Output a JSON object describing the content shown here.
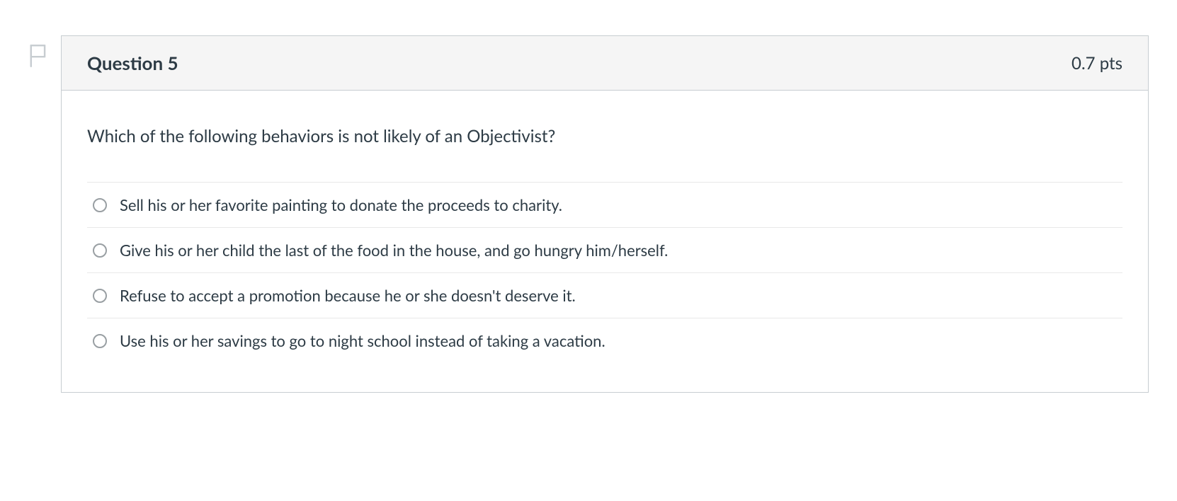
{
  "question": {
    "title": "Question 5",
    "points": "0.7 pts",
    "prompt": "Which of the following behaviors is not likely of an Objectivist?",
    "answers": [
      {
        "text": "Sell his or her favorite painting to donate the proceeds to charity."
      },
      {
        "text": "Give his or her child the last of the food in the house, and go hungry him/herself."
      },
      {
        "text": "Refuse to accept a promotion because he or she doesn't deserve it."
      },
      {
        "text": "Use his or her savings to go to night school instead of taking a vacation."
      }
    ]
  }
}
